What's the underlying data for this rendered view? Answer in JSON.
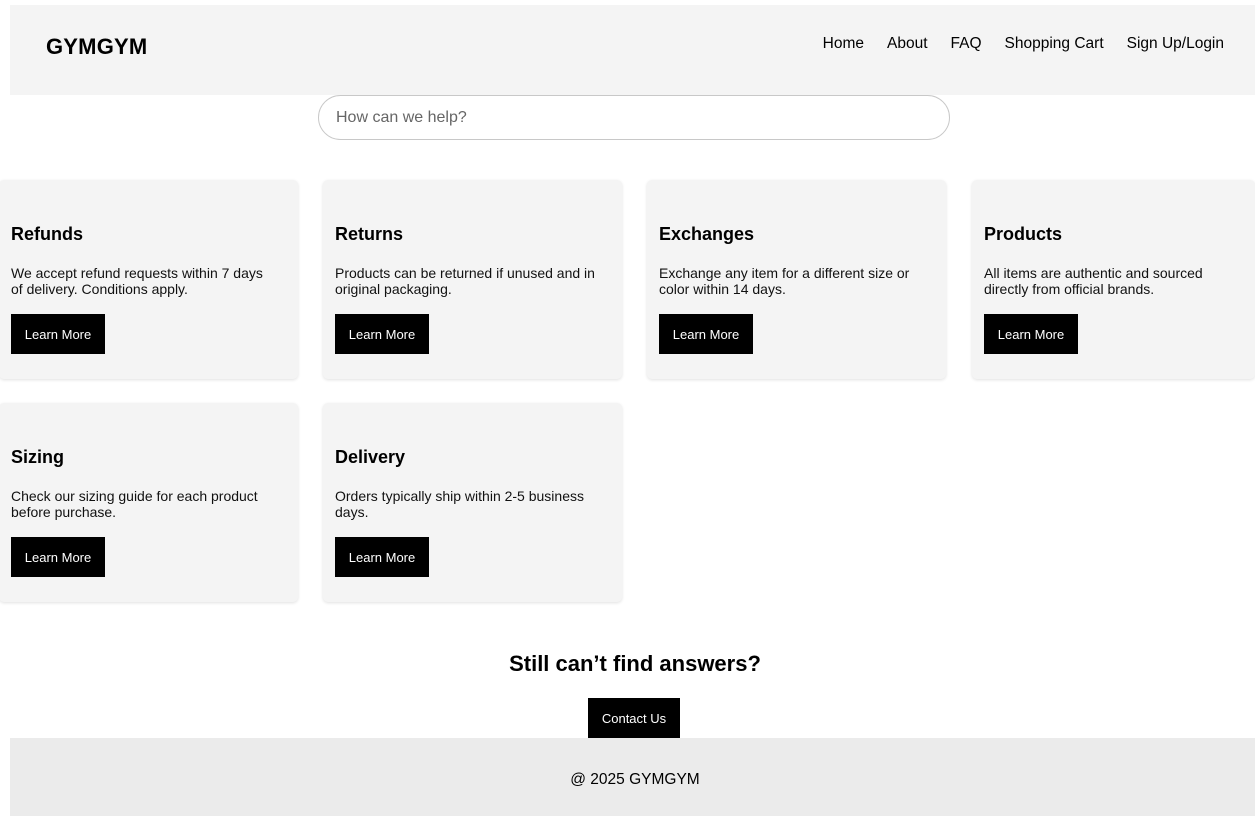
{
  "header": {
    "logo": "GYMGYM",
    "nav": [
      "Home",
      "About",
      "FAQ",
      "Shopping Cart",
      "Sign Up/Login"
    ]
  },
  "search": {
    "placeholder": "How can we help?"
  },
  "cards": [
    {
      "title": "Refunds",
      "text": "We accept refund requests within 7 days of delivery. Conditions apply.",
      "button": "Learn More"
    },
    {
      "title": "Returns",
      "text": "Products can be returned if unused and in original packaging.",
      "button": "Learn More"
    },
    {
      "title": "Exchanges",
      "text": "Exchange any item for a different size or color within 14 days.",
      "button": "Learn More"
    },
    {
      "title": "Products",
      "text": "All items are authentic and sourced directly from official brands.",
      "button": "Learn More"
    },
    {
      "title": "Sizing",
      "text": "Check our sizing guide for each product before purchase.",
      "button": "Learn More"
    },
    {
      "title": "Delivery",
      "text": "Orders typically ship within 2-5 business days.",
      "button": "Learn More"
    }
  ],
  "cta": {
    "title": "Still can’t find answers?",
    "button": "Contact Us"
  },
  "footer": {
    "text": "@ 2025 GYMGYM"
  }
}
